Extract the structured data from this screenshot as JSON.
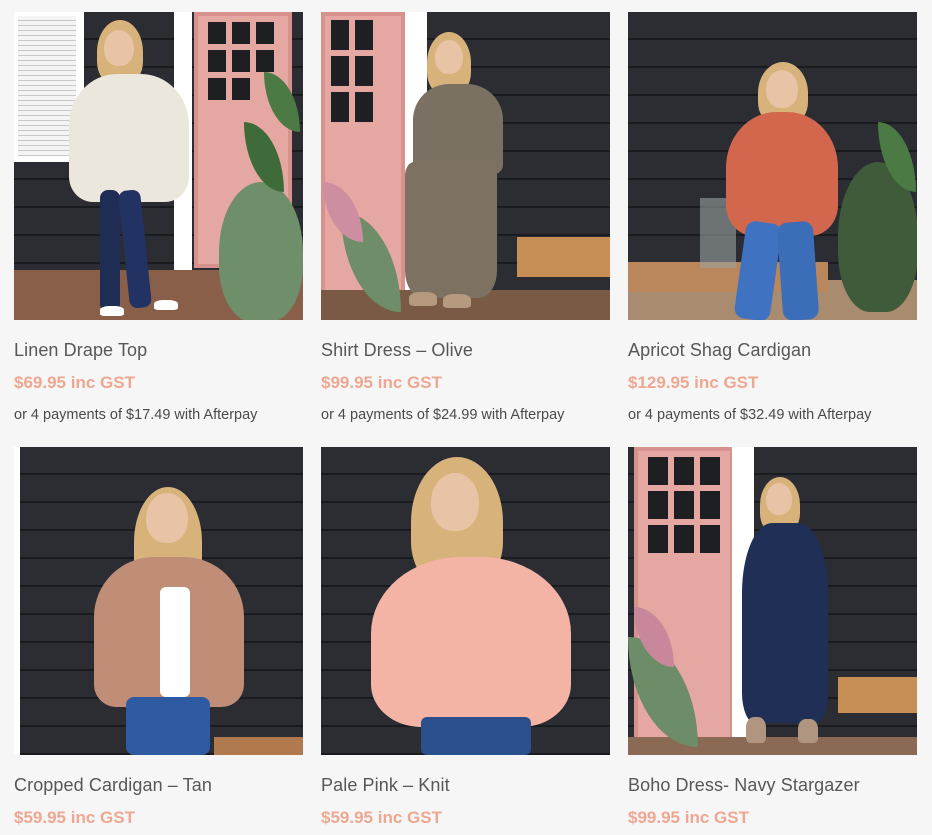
{
  "products": [
    {
      "title": "Linen Drape Top",
      "price": "$69.95 inc GST",
      "afterpay": "or 4 payments of $17.49 with Afterpay"
    },
    {
      "title": "Shirt Dress – Olive",
      "price": "$99.95 inc GST",
      "afterpay": "or 4 payments of $24.99 with Afterpay"
    },
    {
      "title": "Apricot Shag Cardigan",
      "price": "$129.95 inc GST",
      "afterpay": "or 4 payments of $32.49 with Afterpay"
    },
    {
      "title": "Cropped Cardigan – Tan",
      "price": "$59.95 inc GST"
    },
    {
      "title": "Pale Pink – Knit",
      "price": "$59.95 inc GST"
    },
    {
      "title": "Boho Dress- Navy Stargazer",
      "price": "$99.95 inc GST"
    }
  ],
  "colors": {
    "price": "#eea791",
    "title": "#575757",
    "background": "#f6f6f6"
  }
}
